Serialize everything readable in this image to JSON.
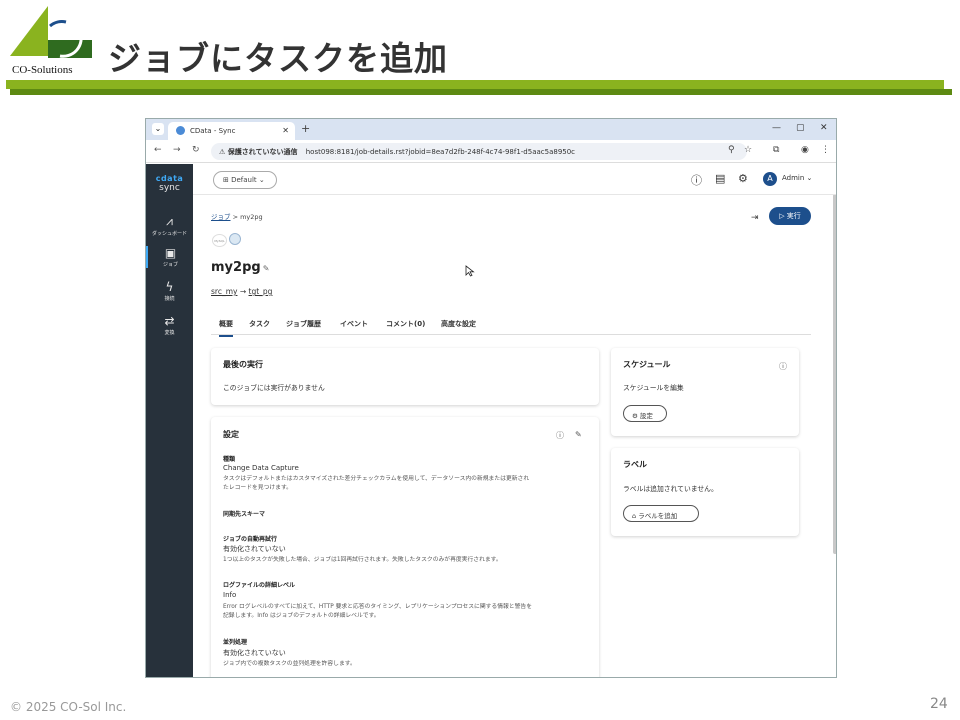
{
  "slide": {
    "title": "ジョブにタスクを追加",
    "logo_text": "CO-Solutions",
    "copyright": "© 2025 CO-Sol Inc.",
    "page_number": "24",
    "colors": {
      "green": "#8ab31f",
      "dark_green": "#5d8a12"
    }
  },
  "browser": {
    "tab_title": "CData - Sync",
    "insecure_label": "⚠ 保護されていない通信",
    "url": "host098:8181/job-details.rst?jobid=8ea7d2fb-248f-4c74-98f1-d5aac5a8950c"
  },
  "sidebar": {
    "brand_top": "cdata",
    "brand_bottom": "sync",
    "items": [
      {
        "label": "ダッシュボード",
        "icon": "chart-icon"
      },
      {
        "label": "ジョブ",
        "icon": "briefcase-icon"
      },
      {
        "label": "接続",
        "icon": "bolt-icon"
      },
      {
        "label": "変換",
        "icon": "transform-icon"
      }
    ]
  },
  "topbar": {
    "workspace": "Default",
    "user": "Admin",
    "avatar_letter": "A"
  },
  "job": {
    "breadcrumb_link": "ジョブ",
    "breadcrumb_current": "my2pg",
    "name": "my2pg",
    "source": "src_my",
    "target": "tgt_pg",
    "run_label": "実行",
    "mysql_logo_text": "MySQL"
  },
  "tabs": [
    "概要",
    "タスク",
    "ジョブ履歴",
    "イベント",
    "コメント(0)",
    "高度な設定"
  ],
  "last_run": {
    "title": "最後の実行",
    "message": "このジョブには実行がありません"
  },
  "settings": {
    "title": "設定",
    "type_label": "種類",
    "type_value": "Change Data Capture",
    "type_desc1": "タスクはデフォルトまたはカスタマイズされた差分チェックカラムを使用して、データソース内の新規または更新され",
    "type_desc2": "たレコードを見つけます。",
    "schema_label": "同期先スキーマ",
    "retry_label": "ジョブの自動再試行",
    "retry_value": "有効化されていない",
    "retry_desc": "1つ以上のタスクが失敗した場合、ジョブは1回再試行されます。失敗したタスクのみが再度実行されます。",
    "log_label": "ログファイルの詳細レベル",
    "log_value": "Info",
    "log_desc1": "Error ログレベルのすべてに加えて、HTTP 要求と応答のタイミング、レプリケーションプロセスに関する情報と警告を",
    "log_desc2": "記録します。Info はジョブのデフォルトの詳細レベルです。",
    "parallel_label": "並列処理",
    "parallel_value": "有効化されていない",
    "parallel_desc": "ジョブ内での複数タスクの並列処理を許容します。"
  },
  "schedule": {
    "title": "スケジュール",
    "edit_text": "スケジュールを編集",
    "button": "設定"
  },
  "labels": {
    "title": "ラベル",
    "message": "ラベルは追加されていません。",
    "button": "ラベルを追加"
  }
}
